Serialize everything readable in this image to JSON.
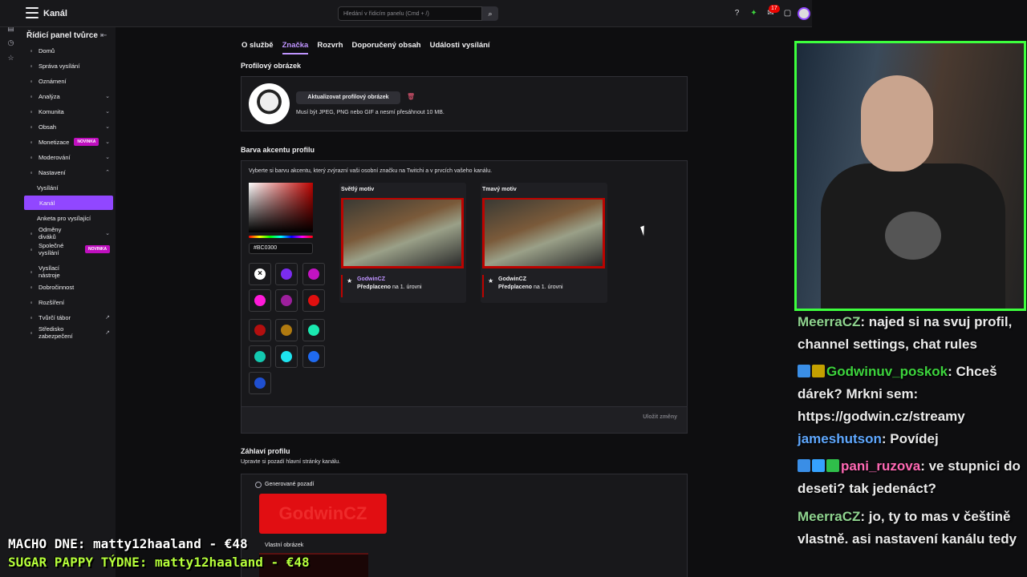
{
  "topbar": {
    "title": "Kanál",
    "search_placeholder": "Hledání v řídicím panelu (Cmd + /)",
    "notification_count": "17"
  },
  "sidebar": {
    "title": "Řídicí panel tvůrce",
    "items": [
      {
        "label": "Domů",
        "icon": "home-icon"
      },
      {
        "label": "Správa vysílání",
        "icon": "broadcast-icon"
      },
      {
        "label": "Oznámení",
        "icon": "megaphone-icon"
      },
      {
        "label": "Analýza",
        "icon": "chart-icon",
        "chevron": "down"
      },
      {
        "label": "Komunita",
        "icon": "community-icon",
        "chevron": "down"
      },
      {
        "label": "Obsah",
        "icon": "content-icon",
        "chevron": "down"
      },
      {
        "label": "Monetizace",
        "icon": "money-icon",
        "chevron": "down",
        "badge": "NOVINKA"
      },
      {
        "label": "Moderování",
        "icon": "sword-icon",
        "chevron": "down"
      },
      {
        "label": "Nastavení",
        "icon": "gear-icon",
        "chevron": "up"
      },
      {
        "label": "Vysílání",
        "sub": true
      },
      {
        "label": "Kanál",
        "sub": true,
        "active": true
      },
      {
        "label": "Anketa pro vysílající",
        "sub": true
      },
      {
        "label": "Odměny diváků",
        "icon": "reward-icon",
        "chevron": "down"
      },
      {
        "label": "Společné vysílání",
        "icon": "collab-icon",
        "badge": "NOVINKA"
      },
      {
        "label": "Vysílací nástroje",
        "icon": "tools-icon"
      },
      {
        "label": "Dobročinnost",
        "icon": "heart-icon"
      },
      {
        "label": "Rozšíření",
        "icon": "puzzle-icon"
      },
      {
        "label": "Tvůrčí tábor",
        "icon": "camp-icon",
        "external": true
      },
      {
        "label": "Středisko zabezpečení",
        "icon": "shield-icon",
        "external": true
      }
    ]
  },
  "tabs": [
    "O službě",
    "Značka",
    "Rozvrh",
    "Doporučený obsah",
    "Události vysílání"
  ],
  "active_tab": "Značka",
  "profile_picture": {
    "title": "Profilový obrázek",
    "update_button": "Aktualizovat profilový obrázek",
    "note": "Musí být JPEG, PNG nebo GIF a nesmí přesáhnout 10 MB."
  },
  "accent": {
    "title": "Barva akcentu profilu",
    "description": "Vyberte si barvu akcentu, který zvýrazní vaši osobní značku na Twitchi a v prvcích vašeho kanálu.",
    "hex_value": "#BC0300",
    "swatches": [
      "none",
      "#7b2cf0",
      "#c213c2",
      "#ff1ad9",
      "#9c1f9c",
      "#e00f0f",
      "#b30f0f",
      "#b07a10",
      "#1ae8b0",
      "#13c9b0",
      "#1ee4f0",
      "#1f6af0",
      "#1f4fd0"
    ],
    "light_theme": {
      "label": "Světlý motiv",
      "name": "GodwinCZ",
      "sub_prefix": "Předplaceno",
      "sub_suffix": "na 1. úrovni"
    },
    "dark_theme": {
      "label": "Tmavý motiv",
      "name": "GodwinCZ",
      "sub_prefix": "Předplaceno",
      "sub_suffix": "na 1. úrovni"
    },
    "save_button": "Uložit změny",
    "accent_color": "#bc0300"
  },
  "header_section": {
    "title": "Záhlaví profilu",
    "subtitle": "Upravte si pozadí hlavní stránky kanálu.",
    "generated_label": "Generované pozadí",
    "banner_text": "GodwinCZ",
    "own_label": "Vlastní obrázek"
  },
  "chat": [
    {
      "user": "MeerraCZ",
      "color": "#8fd48f",
      "text": ": najed si na svuj profil, channel settings, chat rules"
    },
    {
      "user": "Godwinuv_poskok",
      "color": "#3dd43d",
      "text": ": Chceš dárek? Mrkni sem: https://godwin.cz/streamy",
      "icons": [
        "#3a8ee6",
        "#c4a000"
      ]
    },
    {
      "user": "jameshutson",
      "color": "#5fa8ff",
      "text": ": Povídej"
    },
    {
      "user": "pani_ruzova",
      "color": "#ff69b4",
      "text": ": ve stupnici do deseti? tak jedenáct?",
      "icons": [
        "#3a8ee6",
        "#35a2ff",
        "#2fbf4a"
      ]
    },
    {
      "user": "MeerraCZ",
      "color": "#8fd48f",
      "text": ": jo, ty to mas v češtině vlastně. asi nastavení kanálu tedy"
    }
  ],
  "overlay": {
    "line1": "MACHO DNE: matty12haaland - €48",
    "line2": "SUGAR PAPPY TÝDNE: matty12haaland - €48",
    "line1_color": "#ffffff",
    "line2_color": "#b6ff3b"
  }
}
